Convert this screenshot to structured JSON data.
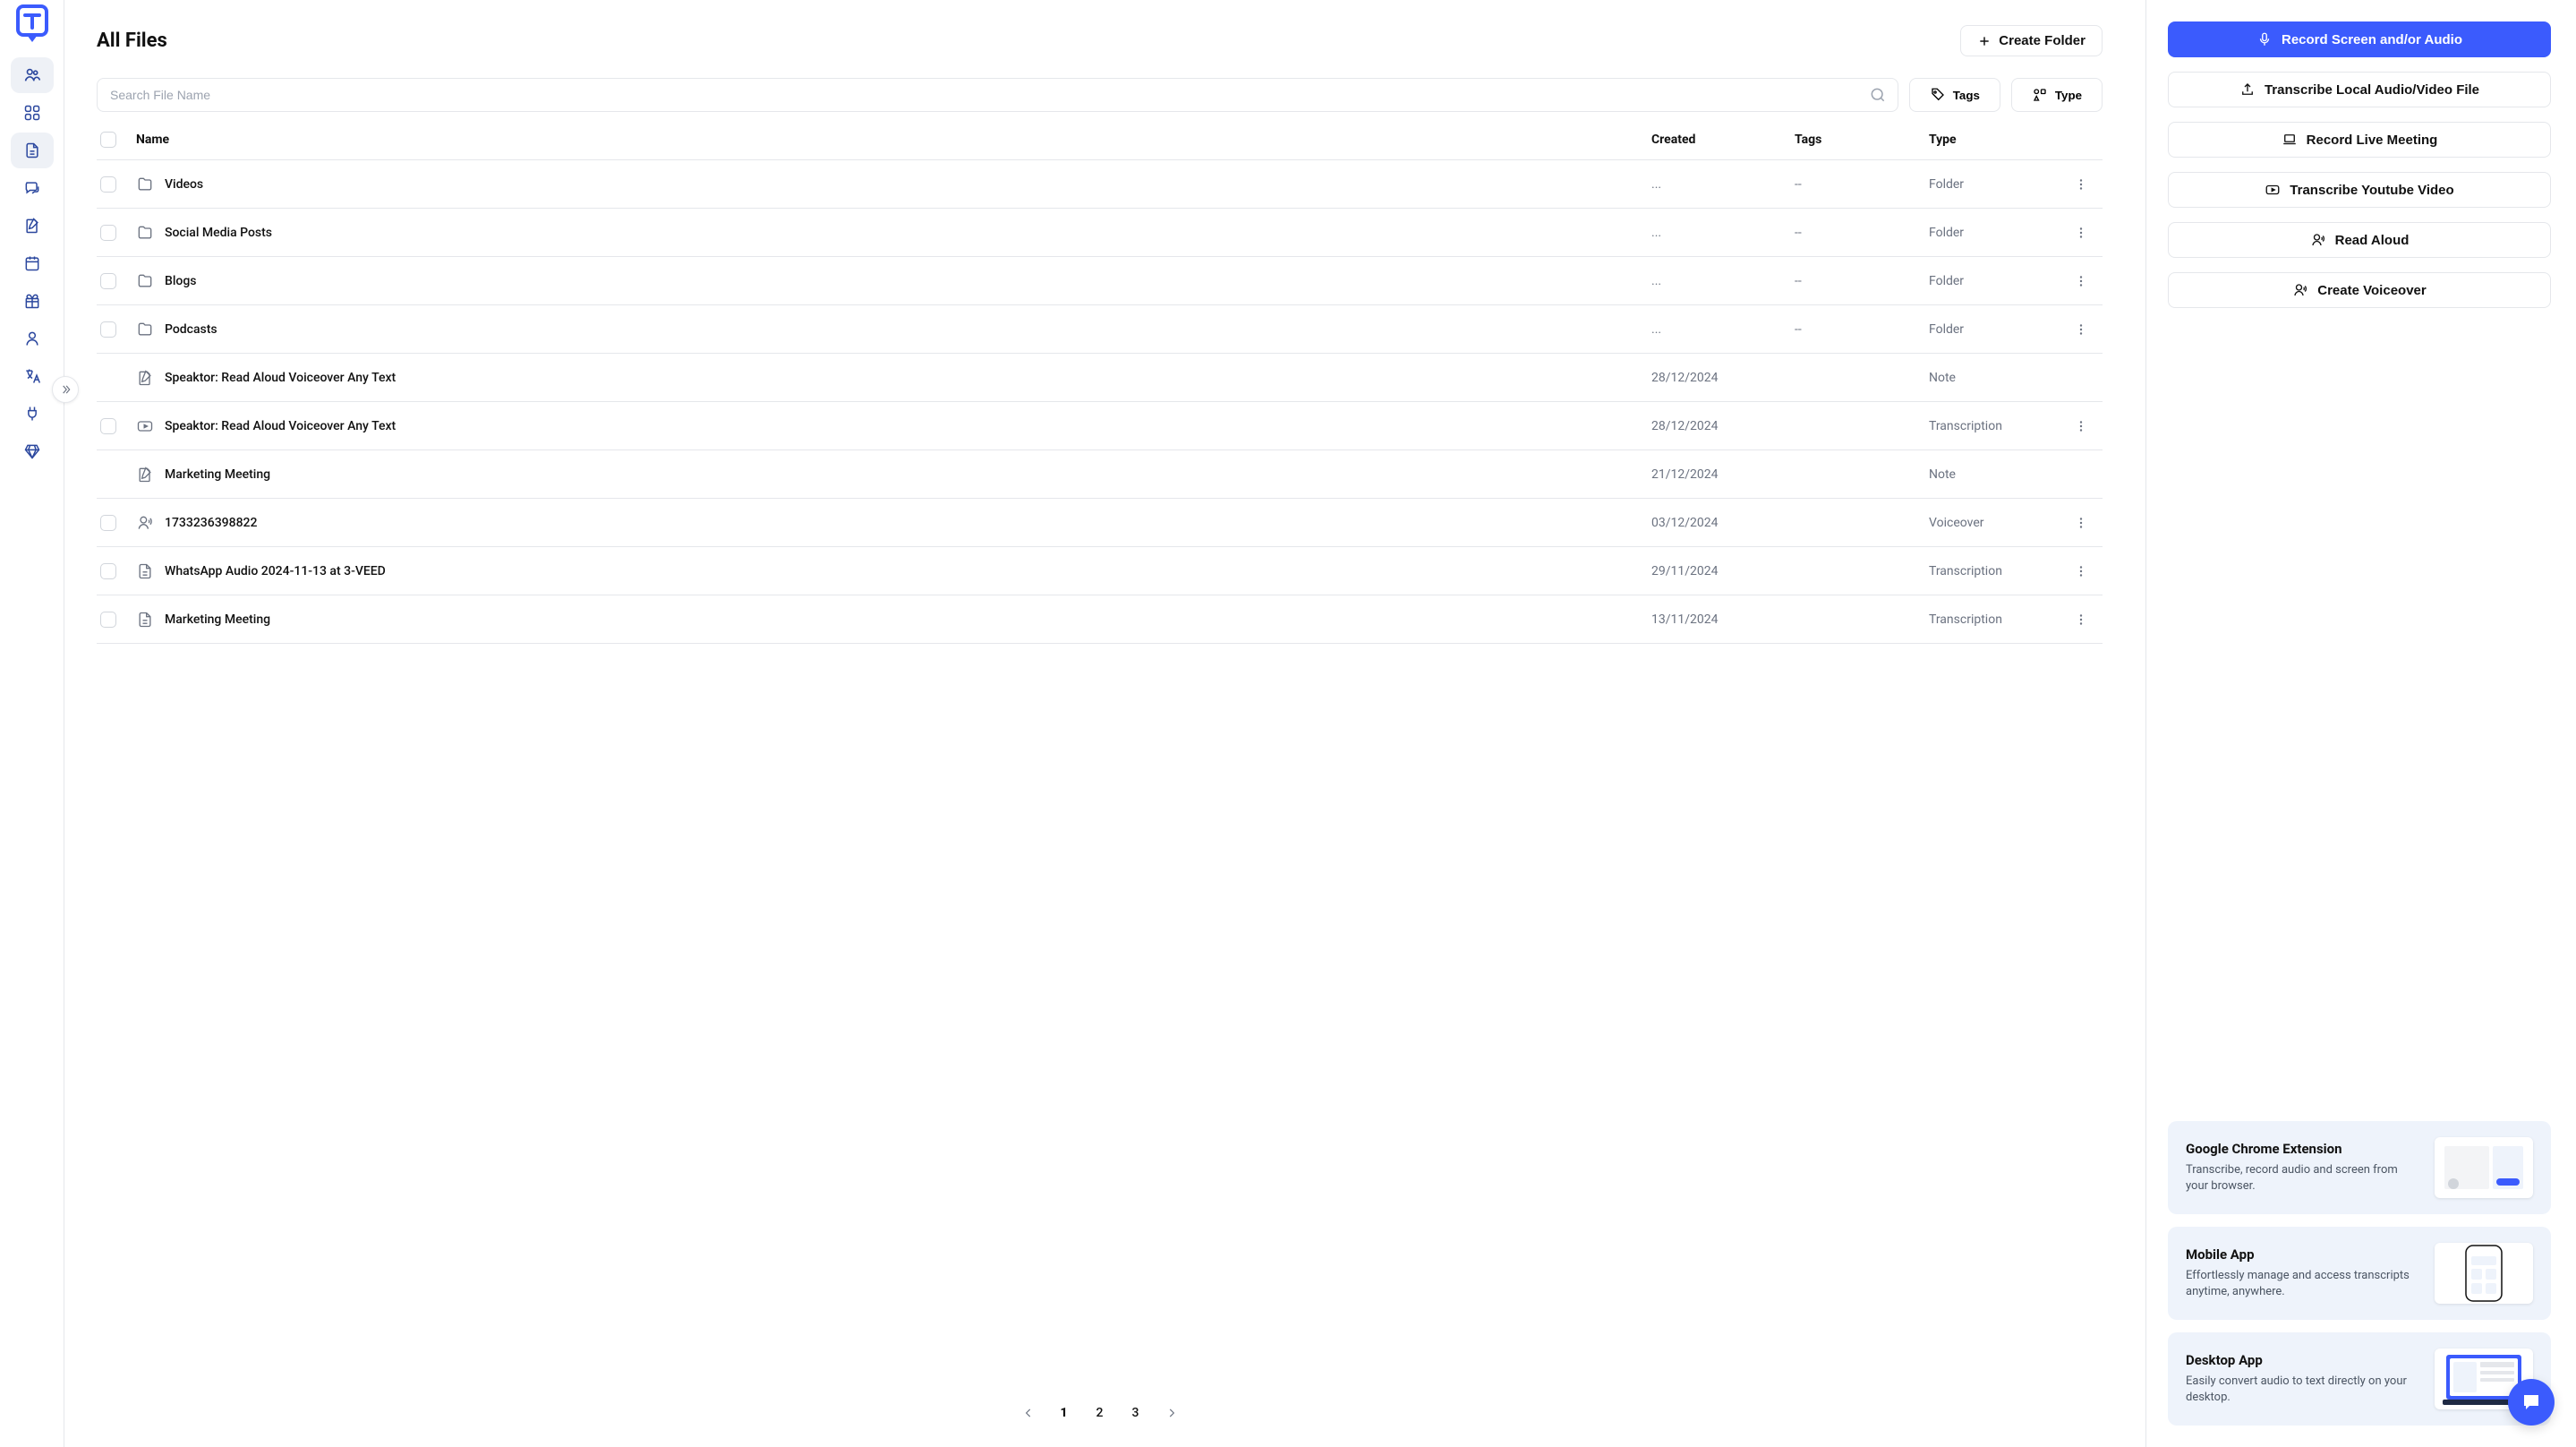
{
  "page_title": "All Files",
  "create_folder_label": "Create Folder",
  "search": {
    "placeholder": "Search File Name"
  },
  "filters": {
    "tags_label": "Tags",
    "type_label": "Type"
  },
  "columns": {
    "name": "Name",
    "created": "Created",
    "tags": "Tags",
    "type": "Type"
  },
  "rows": [
    {
      "icon": "folder",
      "name": "Videos",
      "created": "...",
      "tags": "--",
      "type": "Folder",
      "checkbox": true,
      "more": true
    },
    {
      "icon": "folder",
      "name": "Social Media Posts",
      "created": "...",
      "tags": "--",
      "type": "Folder",
      "checkbox": true,
      "more": true
    },
    {
      "icon": "folder",
      "name": "Blogs",
      "created": "...",
      "tags": "--",
      "type": "Folder",
      "checkbox": true,
      "more": true
    },
    {
      "icon": "folder",
      "name": "Podcasts",
      "created": "...",
      "tags": "--",
      "type": "Folder",
      "checkbox": true,
      "more": true
    },
    {
      "icon": "note",
      "name": "Speaktor: Read Aloud Voiceover Any Text",
      "created": "28/12/2024",
      "tags": "",
      "type": "Note",
      "checkbox": false,
      "more": false
    },
    {
      "icon": "video",
      "name": "Speaktor: Read Aloud Voiceover Any Text",
      "created": "28/12/2024",
      "tags": "",
      "type": "Transcription",
      "checkbox": true,
      "more": true
    },
    {
      "icon": "note",
      "name": "Marketing Meeting",
      "created": "21/12/2024",
      "tags": "",
      "type": "Note",
      "checkbox": false,
      "more": false
    },
    {
      "icon": "voice",
      "name": "1733236398822",
      "created": "03/12/2024",
      "tags": "",
      "type": "Voiceover",
      "checkbox": true,
      "more": true
    },
    {
      "icon": "doc",
      "name": "WhatsApp Audio 2024-11-13 at 3-VEED",
      "created": "29/11/2024",
      "tags": "",
      "type": "Transcription",
      "checkbox": true,
      "more": true
    },
    {
      "icon": "doc",
      "name": "Marketing Meeting",
      "created": "13/11/2024",
      "tags": "",
      "type": "Transcription",
      "checkbox": true,
      "more": true
    }
  ],
  "pagination": {
    "pages": [
      "1",
      "2",
      "3"
    ],
    "active": 0
  },
  "actions": {
    "record_screen": "Record Screen and/or Audio",
    "transcribe_local": "Transcribe Local Audio/Video File",
    "record_meeting": "Record Live Meeting",
    "transcribe_youtube": "Transcribe Youtube Video",
    "read_aloud": "Read Aloud",
    "create_voiceover": "Create Voiceover"
  },
  "cards": [
    {
      "title": "Google Chrome Extension",
      "desc": "Transcribe, record audio and screen from your browser."
    },
    {
      "title": "Mobile App",
      "desc": "Effortlessly manage and access transcripts anytime, anywhere."
    },
    {
      "title": "Desktop App",
      "desc": "Easily convert audio to text directly on your desktop."
    }
  ]
}
